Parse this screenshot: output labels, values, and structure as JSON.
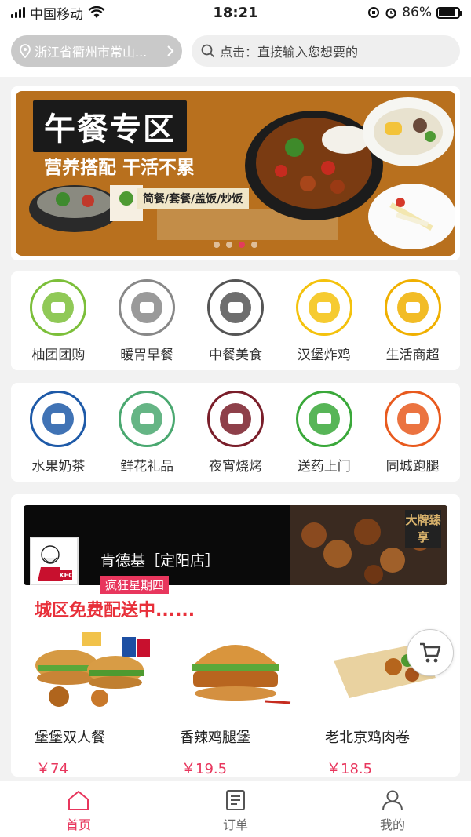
{
  "status_bar": {
    "carrier": "中国移动",
    "time": "18:21",
    "battery": "86%",
    "battery_level": 0.86
  },
  "header": {
    "location": "浙江省衢州市常山...",
    "search_placeholder": "点击：直接输入您想要的"
  },
  "banner": {
    "title": "午餐专区",
    "subtitle": "营养搭配 干活不累",
    "tag": "简餐/套餐/盖饭/炒饭",
    "slide_count": 4,
    "active_slide": 3
  },
  "categories_row1": [
    {
      "label": "柚团团购",
      "icon": "basket-icon",
      "color": "#7cbf3a"
    },
    {
      "label": "暖胃早餐",
      "icon": "breakfast-icon",
      "color": "#888888"
    },
    {
      "label": "中餐美食",
      "icon": "chinese-food-icon",
      "color": "#555555"
    },
    {
      "label": "汉堡炸鸡",
      "icon": "burger-icon",
      "color": "#f4c20d"
    },
    {
      "label": "生活商超",
      "icon": "cart-icon",
      "color": "#f0b000"
    }
  ],
  "categories_row2": [
    {
      "label": "水果奶茶",
      "icon": "milk-tea-icon",
      "color": "#1e5aa8"
    },
    {
      "label": "鲜花礼品",
      "icon": "flower-icon",
      "color": "#4aa870"
    },
    {
      "label": "夜宵烧烤",
      "icon": "bbq-icon",
      "color": "#7a1e2a"
    },
    {
      "label": "送药上门",
      "icon": "medicine-icon",
      "color": "#3aa83a"
    },
    {
      "label": "同城跑腿",
      "icon": "runner-icon",
      "color": "#e85a1e"
    }
  ],
  "store": {
    "name": "肯德基［定阳店］",
    "badge": "大牌臻享",
    "logo_text": "KFC",
    "promo_tag": "疯狂星期四",
    "promo_text": "城区免费配送中......",
    "products": [
      {
        "name": "堡堡双人餐",
        "price": "￥74"
      },
      {
        "name": "香辣鸡腿堡",
        "price": "￥19.5"
      },
      {
        "name": "老北京鸡肉卷",
        "price": "￥18.5"
      }
    ]
  },
  "tabbar": [
    {
      "label": "首页",
      "icon": "home-icon",
      "active": true
    },
    {
      "label": "订单",
      "icon": "order-icon",
      "active": false
    },
    {
      "label": "我的",
      "icon": "profile-icon",
      "active": false
    }
  ],
  "colors": {
    "accent": "#e8365d",
    "promo_red": "#e8303a",
    "banner_bg": "#b8701e"
  }
}
